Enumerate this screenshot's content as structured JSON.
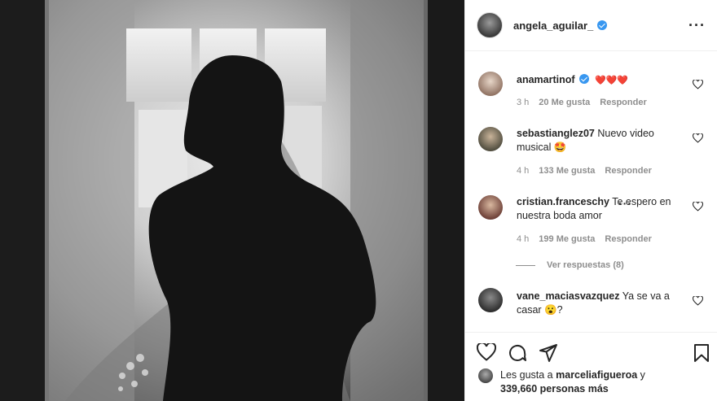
{
  "post": {
    "username": "angela_aguilar_",
    "verified": true,
    "more_icon": "more-horizontal-icon"
  },
  "comments": [
    {
      "username": "anamartinof",
      "verified": true,
      "text": "",
      "emoji": "❤️❤️❤️",
      "time": "3 h",
      "likes": "20 Me gusta",
      "reply": "Responder"
    },
    {
      "username": "sebastianglez07",
      "verified": false,
      "text": "Nuevo video musical",
      "emoji": "🤩",
      "time": "4 h",
      "likes": "133 Me gusta",
      "reply": "Responder"
    },
    {
      "username": "cristian.franceschy",
      "verified": false,
      "text": "Te espero en nuestra boda amor",
      "emoji": "",
      "time": "4 h",
      "likes": "199 Me gusta",
      "reply": "Responder"
    },
    {
      "username": "vane_maciasvazquez",
      "verified": false,
      "text": "Ya se va a casar",
      "emoji": "😮",
      "suffix": "?",
      "time": "",
      "likes": "",
      "reply": ""
    }
  ],
  "view_replies": "Ver respuestas (8)",
  "actions": {
    "like_icon": "heart-icon",
    "comment_icon": "comment-icon",
    "share_icon": "send-icon",
    "save_icon": "bookmark-icon"
  },
  "likes_summary": {
    "prefix": "Les gusta a",
    "user": "marceliafigueroa",
    "conj": "y",
    "count": "339,660 personas más"
  },
  "colors": {
    "verified": "#3897f0",
    "muted": "#8e8e8e",
    "text": "#262626"
  }
}
